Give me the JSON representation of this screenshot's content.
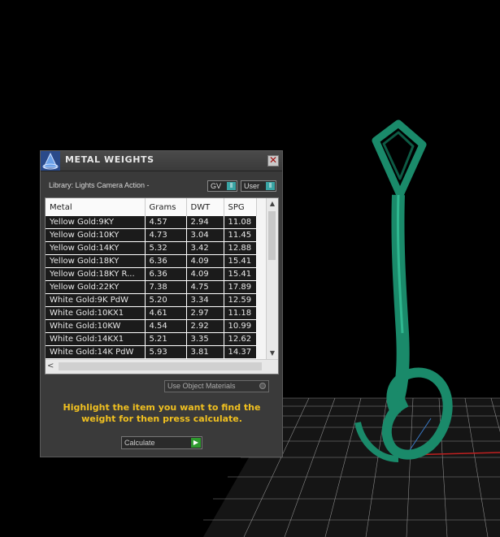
{
  "dialog": {
    "title": "METAL WEIGHTS",
    "library": "Library: Lights Camera Action -",
    "unit_select": "GV",
    "mode_select": "User",
    "columns": [
      "Metal",
      "Grams",
      "DWT",
      "SPG"
    ],
    "rows": [
      [
        "Yellow Gold:9KY",
        "4.57",
        "2.94",
        "11.08"
      ],
      [
        "Yellow Gold:10KY",
        "4.73",
        "3.04",
        "11.45"
      ],
      [
        "Yellow Gold:14KY",
        "5.32",
        "3.42",
        "12.88"
      ],
      [
        "Yellow Gold:18KY",
        "6.36",
        "4.09",
        "15.41"
      ],
      [
        "Yellow Gold:18KY R...",
        "6.36",
        "4.09",
        "15.41"
      ],
      [
        "Yellow Gold:22KY",
        "7.38",
        "4.75",
        "17.89"
      ],
      [
        "White Gold:9K PdW",
        "5.20",
        "3.34",
        "12.59"
      ],
      [
        "White Gold:10KX1",
        "4.61",
        "2.97",
        "11.18"
      ],
      [
        "White Gold:10KW",
        "4.54",
        "2.92",
        "10.99"
      ],
      [
        "White Gold:14KX1",
        "5.21",
        "3.35",
        "12.62"
      ],
      [
        "White Gold:14K PdW",
        "5.93",
        "3.81",
        "14.37"
      ]
    ],
    "use_object_materials": "Use Object Materials",
    "hint": "Highlight the item you want to find the weight for then press calculate.",
    "calculate_label": "Calculate"
  },
  "colors": {
    "background": "#000000",
    "model_green": "#1a8a6a",
    "hint_yellow": "#f0c020",
    "accent_teal": "#3aa4a4"
  }
}
